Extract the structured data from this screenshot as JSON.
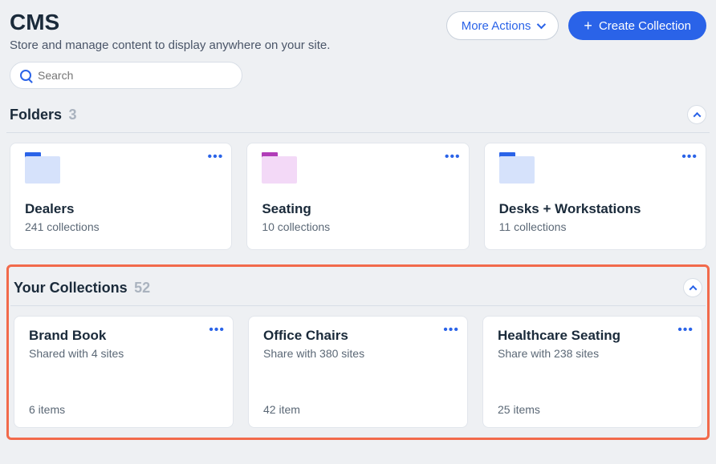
{
  "header": {
    "title": "CMS",
    "subtitle": "Store and manage content to display anywhere on your site.",
    "moreActions": "More Actions",
    "createCollection": "Create Collection"
  },
  "search": {
    "placeholder": "Search"
  },
  "folders": {
    "title": "Folders",
    "count": "3",
    "items": [
      {
        "name": "Dealers",
        "sub": "241 collections",
        "color": "blue"
      },
      {
        "name": "Seating",
        "sub": "10 collections",
        "color": "purple"
      },
      {
        "name": "Desks + Workstations",
        "sub": "11 collections",
        "color": "blue"
      }
    ]
  },
  "collections": {
    "title": "Your Collections",
    "count": "52",
    "items": [
      {
        "name": "Brand Book",
        "sub": "Shared with 4 sites",
        "items": "6 items"
      },
      {
        "name": "Office Chairs",
        "sub": "Share with 380 sites",
        "items": "42 item"
      },
      {
        "name": "Healthcare Seating",
        "sub": "Share with 238 sites",
        "items": "25 items"
      }
    ]
  }
}
